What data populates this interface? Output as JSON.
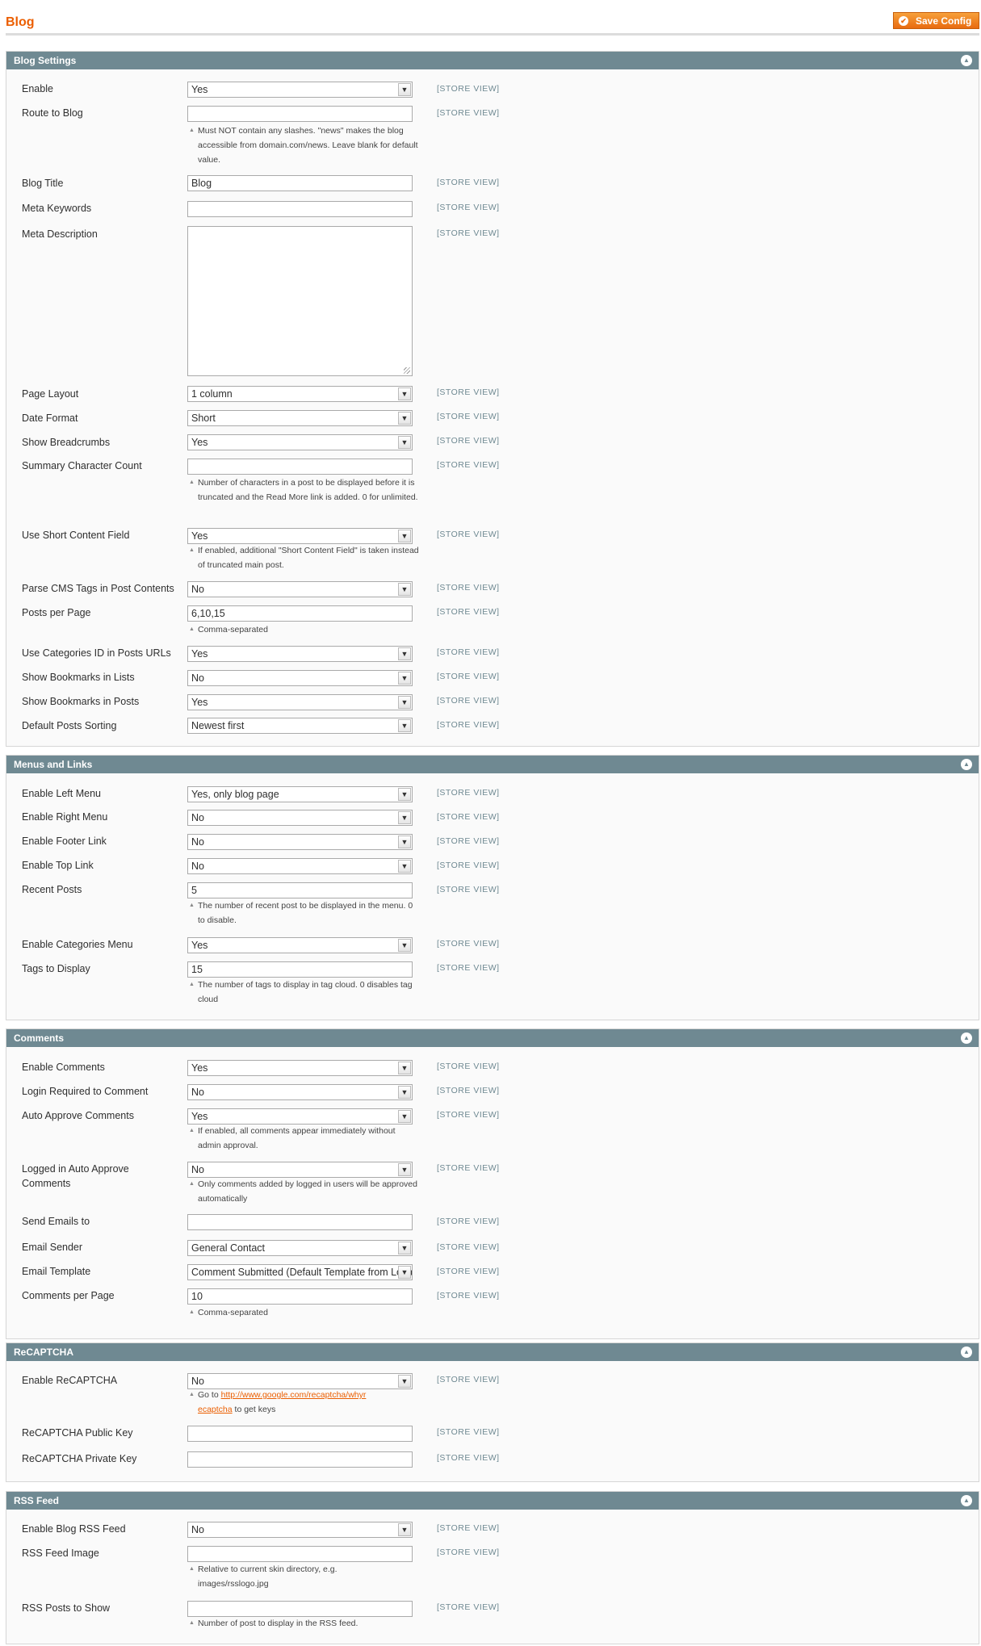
{
  "page": {
    "title": "Blog",
    "save_button": "Save Config",
    "scope_label": "[STORE VIEW]"
  },
  "sections": {
    "blog_settings": {
      "title": "Blog Settings",
      "enable": {
        "label": "Enable",
        "value": "Yes"
      },
      "route": {
        "label": "Route to Blog",
        "value": "",
        "note": "Must NOT contain any slashes. \"news\" makes the blog accessible from domain.com/news. Leave blank for default value."
      },
      "blog_title": {
        "label": "Blog Title",
        "value": "Blog"
      },
      "meta_keywords": {
        "label": "Meta Keywords",
        "value": ""
      },
      "meta_description": {
        "label": "Meta Description",
        "value": ""
      },
      "page_layout": {
        "label": "Page Layout",
        "value": "1 column"
      },
      "date_format": {
        "label": "Date Format",
        "value": "Short"
      },
      "breadcrumbs": {
        "label": "Show Breadcrumbs",
        "value": "Yes"
      },
      "summary_count": {
        "label": "Summary Character Count",
        "value": "",
        "note": "Number of characters in a post to be displayed before it is truncated and the Read More link is added. 0 for unlimited."
      },
      "short_content": {
        "label": "Use Short Content Field",
        "value": "Yes",
        "note": "If enabled, additional \"Short Content Field\" is taken instead of truncated main post."
      },
      "parse_cms": {
        "label": "Parse CMS Tags in Post Contents",
        "value": "No"
      },
      "posts_per_page": {
        "label": "Posts per Page",
        "value": "6,10,15",
        "note": "Comma-separated"
      },
      "categories_id": {
        "label": "Use Categories ID in Posts URLs",
        "value": "Yes"
      },
      "bookmarks_lists": {
        "label": "Show Bookmarks in Lists",
        "value": "No"
      },
      "bookmarks_posts": {
        "label": "Show Bookmarks in Posts",
        "value": "Yes"
      },
      "sorting": {
        "label": "Default Posts Sorting",
        "value": "Newest first"
      }
    },
    "menus": {
      "title": "Menus and Links",
      "left_menu": {
        "label": "Enable Left Menu",
        "value": "Yes, only blog page"
      },
      "right_menu": {
        "label": "Enable Right Menu",
        "value": "No"
      },
      "footer_link": {
        "label": "Enable Footer Link",
        "value": "No"
      },
      "top_link": {
        "label": "Enable Top Link",
        "value": "No"
      },
      "recent_posts": {
        "label": "Recent Posts",
        "value": "5",
        "note": "The number of recent post to be displayed in the menu. 0 to disable."
      },
      "categories_menu": {
        "label": "Enable Categories Menu",
        "value": "Yes"
      },
      "tags": {
        "label": "Tags to Display",
        "value": "15",
        "note": "The number of tags to display in tag cloud. 0 disables tag cloud"
      }
    },
    "comments": {
      "title": "Comments",
      "enable": {
        "label": "Enable Comments",
        "value": "Yes"
      },
      "login_required": {
        "label": "Login Required to Comment",
        "value": "No"
      },
      "auto_approve": {
        "label": "Auto Approve Comments",
        "value": "Yes",
        "note": "If enabled, all comments appear immediately without admin approval."
      },
      "logged_approve": {
        "label": "Logged in Auto Approve Comments",
        "value": "No",
        "note": "Only comments added by logged in users will be approved automatically"
      },
      "send_emails": {
        "label": "Send Emails to",
        "value": ""
      },
      "email_sender": {
        "label": "Email Sender",
        "value": "General Contact"
      },
      "email_template": {
        "label": "Email Template",
        "value": "Comment Submitted (Default Template from Locale)"
      },
      "per_page": {
        "label": "Comments per Page",
        "value": "10",
        "note": "Comma-separated"
      }
    },
    "recaptcha": {
      "title": "ReCAPTCHA",
      "enable": {
        "label": "Enable ReCAPTCHA",
        "value": "No",
        "note_pre": "Go to",
        "link": "http://www.google.com/recaptcha/whyrecaptcha",
        "note_post": "to get keys"
      },
      "public_key": {
        "label": "ReCAPTCHA Public Key",
        "value": ""
      },
      "private_key": {
        "label": "ReCAPTCHA Private Key",
        "value": ""
      }
    },
    "rss": {
      "title": "RSS Feed",
      "enable": {
        "label": "Enable Blog RSS Feed",
        "value": "No"
      },
      "image": {
        "label": "RSS Feed Image",
        "value": "",
        "note": "Relative to current skin directory, e.g. images/rsslogo.jpg"
      },
      "posts": {
        "label": "RSS Posts to Show",
        "value": "",
        "note": "Number of post to display in the RSS feed."
      }
    }
  }
}
